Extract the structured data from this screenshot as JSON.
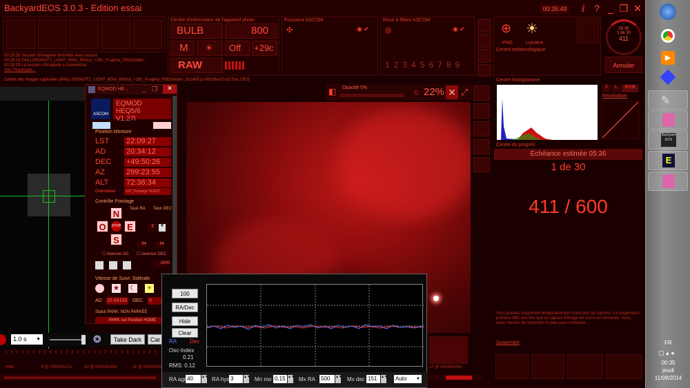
{
  "app": {
    "title": "BackyardEOS 3.0.3 - Edition essai",
    "clock": "00:35:49",
    "title_icons": [
      "info-icon",
      "help-icon",
      "minimize-icon",
      "restore-icon",
      "close-icon"
    ]
  },
  "camera_info": {
    "title": "Centre d'information de l'appareil photo",
    "mode": "BULB",
    "iso": "800",
    "quality": "M",
    "flash": "Off",
    "temp": "+29c",
    "format": "RAW"
  },
  "focuser": {
    "title": "Focuseur ASCOM"
  },
  "filter_wheel": {
    "title": "Roue à filtres ASCOM",
    "slots": [
      "1",
      "2",
      "3",
      "4",
      "5",
      "6",
      "7",
      "8",
      "9"
    ]
  },
  "weather": {
    "title": "Centre météorologique",
    "labels": [
      "PHD",
      "Lumière"
    ]
  },
  "progress_dial": {
    "line1": "05:30",
    "line2": "1 de 30",
    "line3": "411"
  },
  "cancel_button": "Annuler",
  "log": {
    "lines": [
      "00:29:28  Session d'imagerie terminée avec succès.",
      "00:29:28  PAILLON\\NUIT2_LIGHT_600s_800iso_+29c_H-alpha_00533stdev...",
      "00:29:29  La session d'imagerie a commencé.",
      "Voir l'historique..."
    ]
  },
  "captured_images": {
    "title": "Centre des images capturées [PAILLON\\NUIT2_LIGHT_600s_800iso_+29c_H-alpha_00533stdev_20140911-00h28m37s327ms.CR2]"
  },
  "image_toolbar": {
    "opacity": "Opacité 0%",
    "zoom": "22%"
  },
  "histogram": {
    "title": "Centre histogramme",
    "buttons": [
      "2",
      "L",
      "RGB"
    ],
    "reset": "Réinitialiser"
  },
  "progress_center": {
    "title": "Centre du progrès",
    "eta": "Échéance estimée 05:36",
    "count": "1 de 30",
    "seconds": "411 / 600",
    "note": "Vous pouvez suspendre temporairement votre plan de capture. La suspension prendra effet une fois que la capture d'image en cours est terminée. Vous aurez besoin de reprendre le plan pour continuer.",
    "suspend": "Suspendre"
  },
  "bottom_controls": {
    "exposure": "1.0 s",
    "take_dark": "Take Dark",
    "cancel_short": "Car"
  },
  "timeline": {
    "labels": [
      "H4ls",
      "9 @ 00h02m17s",
      "10 @ 00h03m28s",
      "11 @ 00h04m30s",
      "17 @ 00h28m43s"
    ]
  },
  "eqmod": {
    "title": "EQMOD HE...",
    "header": "EQMOD HEQ5/6",
    "version": "V1.27l",
    "logo": "ASCOM",
    "position_title": "Position Monture",
    "lst_label": "LST",
    "lst": "22:09:27",
    "ad_label": "AD",
    "ad": "20:34:12",
    "dec_label": "DEC",
    "dec": "+49:50:26",
    "az_label": "AZ",
    "az": "299:23:55",
    "alt_label": "ALT",
    "alt": "72:36:34",
    "orientation_label": "Orientation",
    "orientation": "1ST_Pointage OUEST",
    "pointing_title": "Contrôle Pointage",
    "taux_ra": "Taux RA",
    "taux_dec": "Taux DEC",
    "dir_n": "N",
    "dir_o": "O",
    "dir_e": "E",
    "dir_s": "S",
    "stop": "STOP",
    "rate_val": "3",
    "rate_ra": "64",
    "rate_dec": "64",
    "inverse_ad": "Inverser AD",
    "inverse_dec": "Inverser DEC",
    "goto_val": "2000",
    "tracking_title": "Vitesse de Suivi: Sidérale",
    "ad_short": "AD",
    "ad_rate": "15.04100",
    "dec_short": "DEC",
    "dec_rate": "0",
    "park_status": "Statut PARK: NON PARKÉE",
    "park_button": "PARK sur Position HOME"
  },
  "guide_graph": {
    "buttons": [
      "100",
      "RA/Dec",
      "Hide",
      "Clear"
    ],
    "legend_ra": "RA",
    "legend_dec": "Dec",
    "osc_label": "Osc-Index",
    "osc_val": "0.21",
    "rms": "RMS: 0.12",
    "ra_agr_label": "RA agr",
    "ra_agr": "40",
    "ra_hys_label": "RA hys",
    "ra_hys": "3",
    "mn_mo_label": "Mn mo",
    "mn_mo": "0.15",
    "mx_ra_label": "Mx RA",
    "mx_ra": "500",
    "mx_dec_label": "Mx dec",
    "mx_dec": "151",
    "mode": "Auto"
  },
  "taskbar": {
    "lang": "FR",
    "time": "00:35",
    "day": "jeudi",
    "date": "11/09/2014",
    "backyard_label": "Backyard EOS"
  },
  "colors": {
    "accent": "#ff3b2f",
    "background": "#1a0000"
  }
}
